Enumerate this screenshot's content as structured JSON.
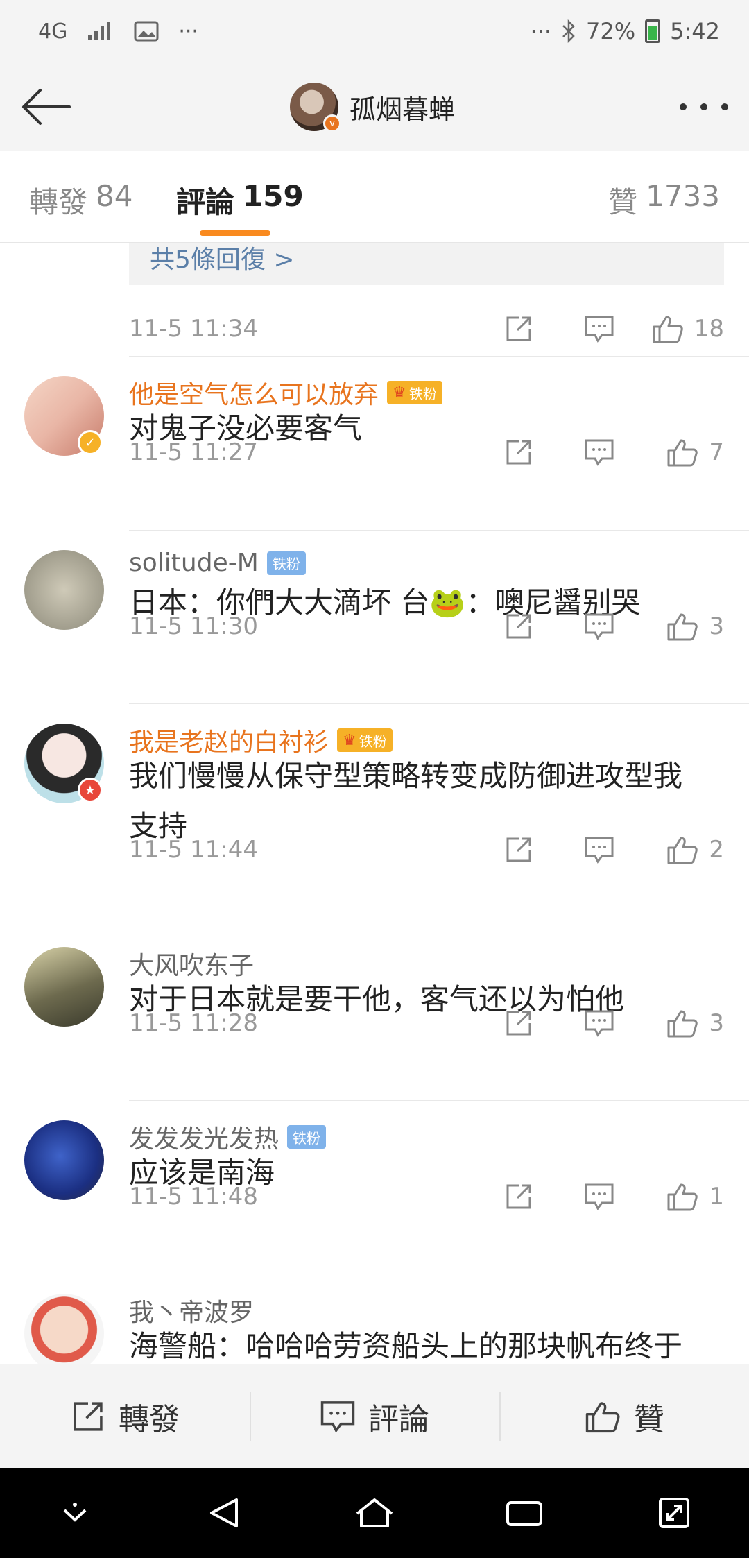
{
  "status_bar": {
    "network": "4G",
    "more": "···",
    "right_more": "···",
    "battery": "72%",
    "time": "5:42"
  },
  "header": {
    "title": "孤烟暮蝉",
    "back_icon": "arrow-left-icon",
    "more_icon": "more-dots-icon"
  },
  "tabs": {
    "repost": {
      "label": "轉發",
      "count": "84"
    },
    "comment": {
      "label": "評論",
      "count": "159"
    },
    "like": {
      "label": "贊",
      "count": "1733"
    }
  },
  "first": {
    "reply_link": "共5條回復 >",
    "time": "11-5 11:34",
    "likes": "18"
  },
  "comments": [
    {
      "name": "他是空气怎么可以放弃",
      "badge": "铁粉",
      "text": "对鬼子没必要客气",
      "time": "11-5 11:27",
      "likes": "7"
    },
    {
      "name": "solitude-M",
      "badge": "铁粉",
      "text": "日本：你們大大滴坏 台🐸：噢尼醤别哭",
      "time": "11-5 11:30",
      "likes": "3"
    },
    {
      "name": "我是老赵的白衬衫",
      "badge": "铁粉",
      "text": "我们慢慢从保守型策略转变成防御进攻型我支持",
      "time": "11-5 11:44",
      "likes": "2"
    },
    {
      "name": "大风吹东子",
      "text": "对于日本就是要干他，客气还以为怕他",
      "time": "11-5 11:28",
      "likes": "3"
    },
    {
      "name": "发发发光发热",
      "badge": "铁粉",
      "text": "应该是南海",
      "time": "11-5 11:48",
      "likes": "1"
    },
    {
      "name": "我丶帝波罗",
      "text": "海警船：哈哈哈劳资船头上的那块帆布终于"
    }
  ],
  "bottom_bar": {
    "repost": "轉發",
    "comment": "評論",
    "like": "贊"
  }
}
